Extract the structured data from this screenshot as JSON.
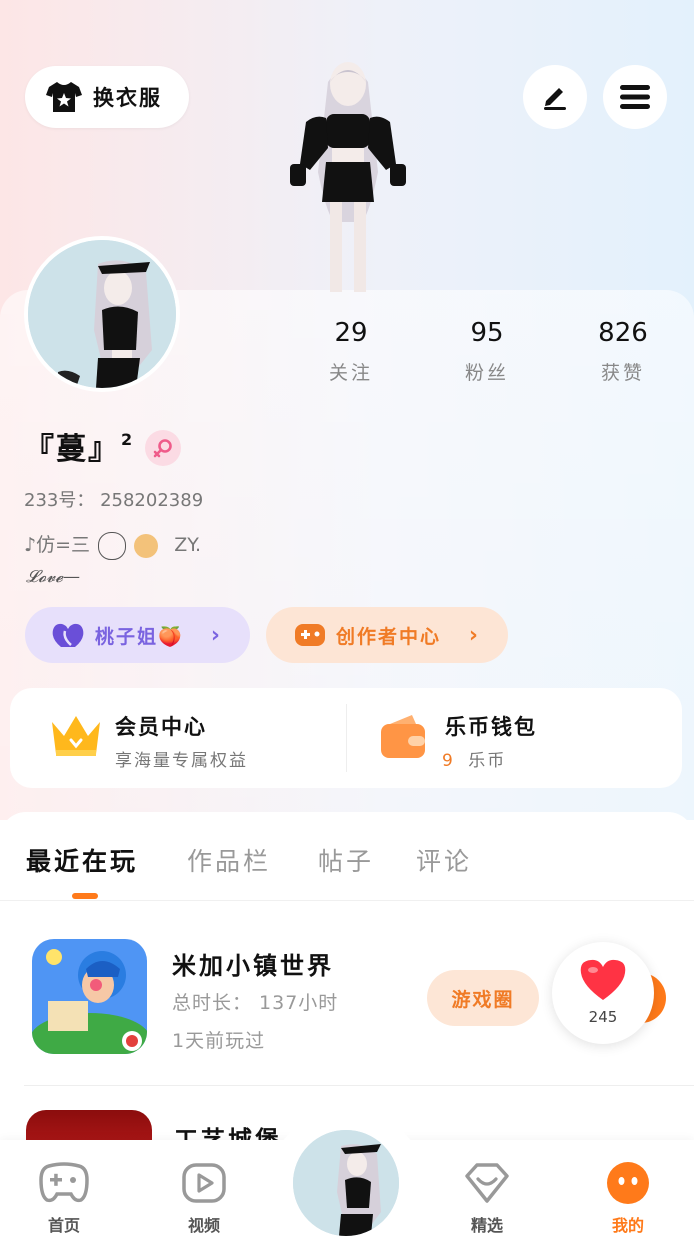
{
  "header": {
    "outfit_label": "换衣服",
    "icons": [
      "shirt-icon",
      "edit-icon",
      "menu-icon"
    ]
  },
  "profile": {
    "stats": [
      {
        "value": "29",
        "label": "关注"
      },
      {
        "value": "95",
        "label": "粉丝"
      },
      {
        "value": "826",
        "label": "获赞"
      }
    ],
    "nickname": "『蔓』",
    "nickname_sup": "2",
    "uid": "233号： 258202389",
    "bio_line1": "♪仿=三",
    "bio_line1_tail": "ZY.",
    "bio_line2": "𝓛𝓸𝓿𝓮—",
    "pills": {
      "peach_label": "桃子姐🍑",
      "creator_label": "创作者中心"
    }
  },
  "member": {
    "vip_title": "会员中心",
    "vip_sub": "享海量专属权益",
    "wallet_title": "乐币钱包",
    "wallet_amount": "9",
    "wallet_unit": "乐币"
  },
  "tabs": [
    "最近在玩",
    "作品栏",
    "帖子",
    "评论"
  ],
  "recent_games": [
    {
      "title": "米加小镇世界",
      "total_time": "总时长： 137小时",
      "last_played": "1天前玩过",
      "circle_label": "游戏圈"
    },
    {
      "title": "工艺城堡 "
    }
  ],
  "floating_heart": {
    "count": "245"
  },
  "bottom_nav": [
    {
      "label": "首页"
    },
    {
      "label": "视频"
    },
    {
      "label": "精选"
    },
    {
      "label": "我的"
    }
  ],
  "colors": {
    "accent": "#ff7a1a",
    "peach_pill": "#7a63e0",
    "heart": "#ff3344"
  }
}
